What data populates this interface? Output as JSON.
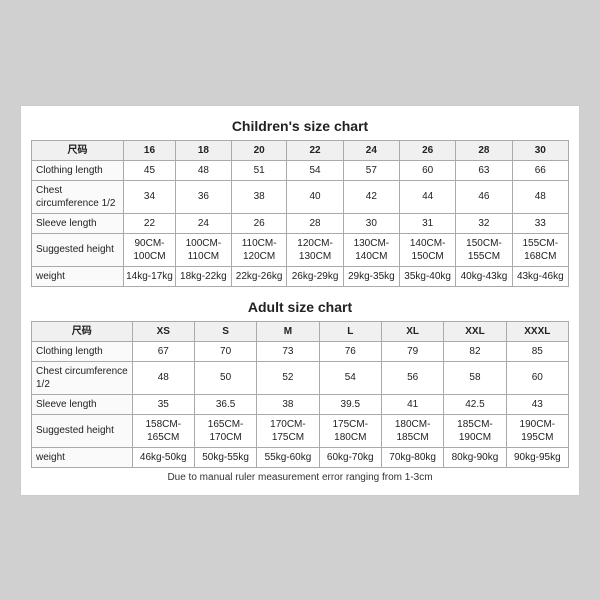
{
  "children_chart": {
    "title": "Children's size chart",
    "columns": [
      "尺码",
      "16",
      "18",
      "20",
      "22",
      "24",
      "26",
      "28",
      "30"
    ],
    "rows": [
      {
        "label": "Clothing length",
        "values": [
          "45",
          "48",
          "51",
          "54",
          "57",
          "60",
          "63",
          "66"
        ]
      },
      {
        "label": "Chest circumference 1/2",
        "values": [
          "34",
          "36",
          "38",
          "40",
          "42",
          "44",
          "46",
          "48"
        ]
      },
      {
        "label": "Sleeve length",
        "values": [
          "22",
          "24",
          "26",
          "28",
          "30",
          "31",
          "32",
          "33"
        ]
      },
      {
        "label": "Suggested height",
        "values": [
          "90CM-100CM",
          "100CM-110CM",
          "110CM-120CM",
          "120CM-130CM",
          "130CM-140CM",
          "140CM-150CM",
          "150CM-155CM",
          "155CM-168CM"
        ]
      },
      {
        "label": "weight",
        "values": [
          "14kg-17kg",
          "18kg-22kg",
          "22kg-26kg",
          "26kg-29kg",
          "29kg-35kg",
          "35kg-40kg",
          "40kg-43kg",
          "43kg-46kg"
        ]
      }
    ]
  },
  "adult_chart": {
    "title": "Adult size chart",
    "columns": [
      "尺码",
      "XS",
      "S",
      "M",
      "L",
      "XL",
      "XXL",
      "XXXL"
    ],
    "rows": [
      {
        "label": "Clothing length",
        "values": [
          "67",
          "70",
          "73",
          "76",
          "79",
          "82",
          "85"
        ]
      },
      {
        "label": "Chest circumference 1/2",
        "values": [
          "48",
          "50",
          "52",
          "54",
          "56",
          "58",
          "60"
        ]
      },
      {
        "label": "Sleeve length",
        "values": [
          "35",
          "36.5",
          "38",
          "39.5",
          "41",
          "42.5",
          "43"
        ]
      },
      {
        "label": "Suggested height",
        "values": [
          "158CM-165CM",
          "165CM-170CM",
          "170CM-175CM",
          "175CM-180CM",
          "180CM-185CM",
          "185CM-190CM",
          "190CM-195CM"
        ]
      },
      {
        "label": "weight",
        "values": [
          "46kg-50kg",
          "50kg-55kg",
          "55kg-60kg",
          "60kg-70kg",
          "70kg-80kg",
          "80kg-90kg",
          "90kg-95kg"
        ]
      }
    ]
  },
  "note": "Due to manual ruler measurement error ranging from 1-3cm"
}
